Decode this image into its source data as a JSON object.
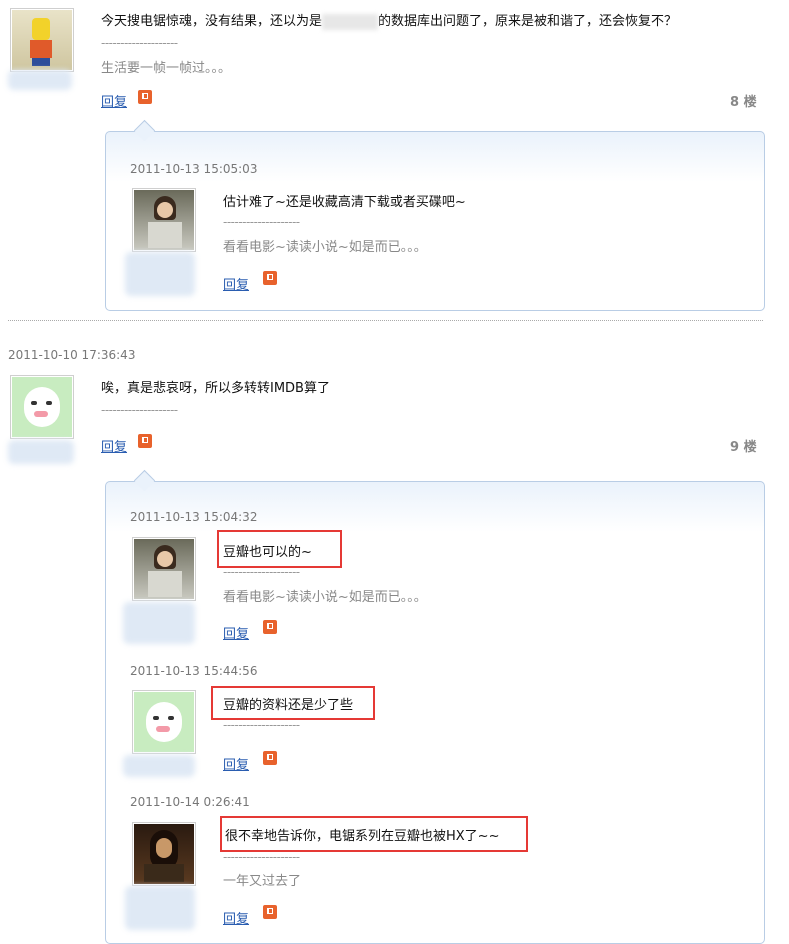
{
  "posts": [
    {
      "text": "今天搜电锯惊魂，没有结果，还以为是",
      "text_tail": "的数据库出问题了，原来是被和谐了，还会恢复不？",
      "divider": "--------------------",
      "signature": "生活要一帧一帧过。。。",
      "reply_label": "回复",
      "floor": "8 楼",
      "replies": [
        {
          "time": "2011-10-13 15:05:03",
          "text": "估计难了~还是收藏高清下载或者买碟吧~",
          "divider": "--------------------",
          "signature": "看看电影~读读小说~如是而已。。。",
          "reply_label": "回复"
        }
      ]
    },
    {
      "time": "2011-10-10 17:36:43",
      "text": "唉，真是悲哀呀，所以多转转IMDB算了",
      "divider": "--------------------",
      "reply_label": "回复",
      "floor": "9 楼",
      "replies": [
        {
          "time": "2011-10-13 15:04:32",
          "text": "豆瓣也可以的~",
          "divider": "--------------------",
          "signature": "看看电影~读读小说~如是而已。。。",
          "reply_label": "回复"
        },
        {
          "time": "2011-10-13 15:44:56",
          "text": "豆瓣的资料还是少了些",
          "divider": "--------------------",
          "reply_label": "回复"
        },
        {
          "time": "2011-10-14 0:26:41",
          "text": "很不幸地告诉你，电锯系列在豆瓣也被HX了~~",
          "divider": "--------------------",
          "signature": "一年又过去了",
          "reply_label": "回复"
        }
      ]
    }
  ],
  "colors": {
    "link": "#2a5db0",
    "highlight": "#e53935",
    "flag": "#e8622c"
  }
}
